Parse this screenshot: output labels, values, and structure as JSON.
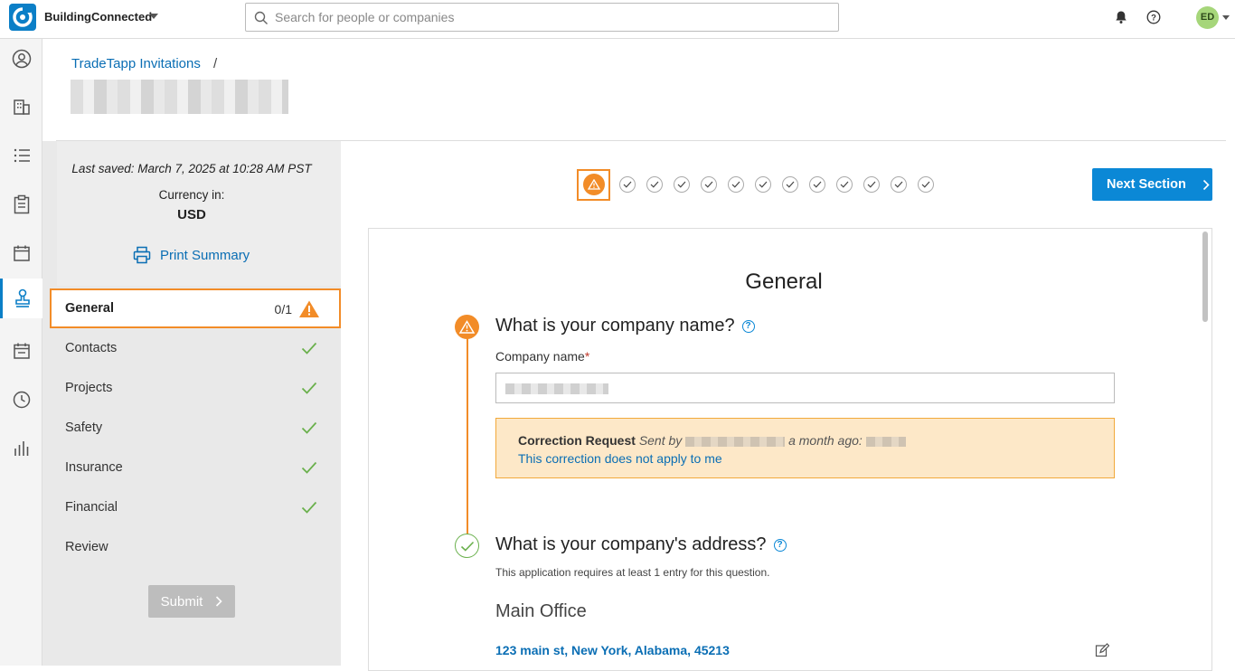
{
  "header": {
    "brand": "BuildingConnected",
    "search_placeholder": "Search for people or companies",
    "avatar_initials": "ED"
  },
  "breadcrumb": {
    "parent": "TradeTapp Invitations",
    "separator": "/"
  },
  "sidebar": {
    "last_saved": "Last saved: March 7, 2025 at 10:28 AM PST",
    "currency_label": "Currency in:",
    "currency_value": "USD",
    "print_label": "Print Summary",
    "sections": [
      {
        "label": "General",
        "count": "0/1",
        "status": "warning"
      },
      {
        "label": "Contacts",
        "status": "complete"
      },
      {
        "label": "Projects",
        "status": "complete"
      },
      {
        "label": "Safety",
        "status": "complete"
      },
      {
        "label": "Insurance",
        "status": "complete"
      },
      {
        "label": "Financial",
        "status": "complete"
      },
      {
        "label": "Review",
        "status": "none"
      }
    ],
    "submit_label": "Submit"
  },
  "stepper": {
    "total_steps": 13,
    "active_step": 1
  },
  "next_section_label": "Next Section",
  "main": {
    "title": "General",
    "question1": {
      "title": "What is your company name?",
      "field_label": "Company name",
      "required_mark": "*",
      "correction_title": "Correction Request",
      "correction_sent_by": "Sent by",
      "correction_when": "a month ago:",
      "correction_link": "This correction does not apply to me"
    },
    "question2": {
      "title": "What is your company's address?",
      "subtitle": "This application requires at least 1 entry for this question.",
      "office_title": "Main Office",
      "address": "123 main st, New York, Alabama, 45213"
    }
  },
  "colors": {
    "accent": "#0b88d6",
    "warning": "#f28c28",
    "success": "#6ab04c",
    "link": "#0a6eb4"
  }
}
